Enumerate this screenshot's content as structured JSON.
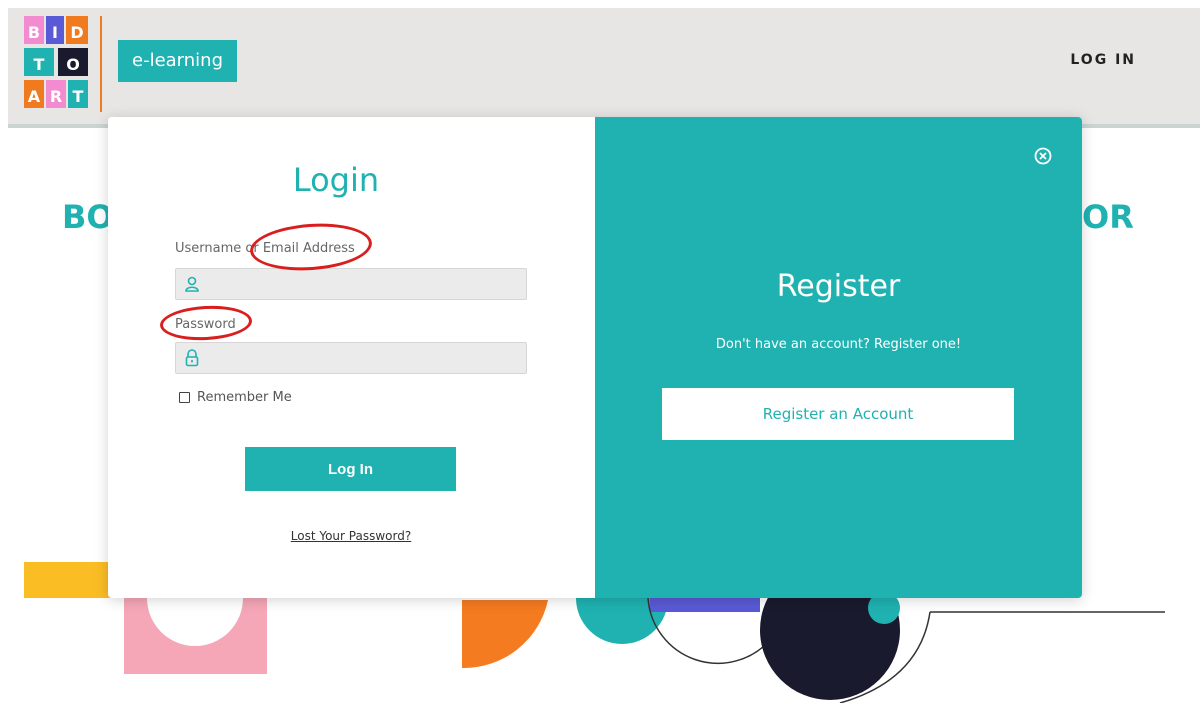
{
  "header": {
    "logo_lines": [
      "BID",
      "TO",
      "ART"
    ],
    "badge": "e-learning",
    "login_link": "LOG IN"
  },
  "hero": {
    "left_text": "BO",
    "right_text": "OR"
  },
  "login": {
    "title": "Login",
    "username_label": "Username or Email Address",
    "username_value": "",
    "password_label": "Password",
    "password_value": "",
    "remember_label": "Remember Me",
    "remember_checked": false,
    "submit_label": "Log In",
    "lost_password": "Lost Your Password?"
  },
  "register": {
    "title": "Register",
    "text": "Don't have an account? Register one!",
    "button_label": "Register an Account"
  },
  "colors": {
    "brand_teal": "#1fb2b1",
    "header_bg": "#e8e6e4",
    "annotation_red": "#d91e1e"
  },
  "icons": {
    "username": "user-icon",
    "password": "lock-icon",
    "close": "close-circle-icon"
  }
}
